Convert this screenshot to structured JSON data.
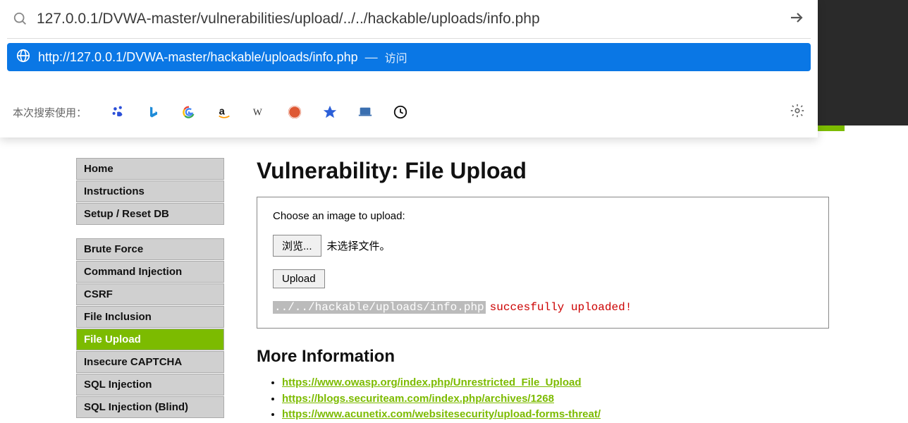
{
  "omnibox": {
    "value": "127.0.0.1/DVWA-master/vulnerabilities/upload/../../hackable/uploads/info.php"
  },
  "suggestion": {
    "url": "http://127.0.0.1/DVWA-master/hackable/uploads/info.php",
    "action": "访问"
  },
  "engines": {
    "label": "本次搜索使用："
  },
  "sidebar": {
    "group1": [
      "Home",
      "Instructions",
      "Setup / Reset DB"
    ],
    "group2": [
      "Brute Force",
      "Command Injection",
      "CSRF",
      "File Inclusion",
      "File Upload",
      "Insecure CAPTCHA",
      "SQL Injection",
      "SQL Injection (Blind)"
    ],
    "active": "File Upload"
  },
  "main": {
    "heading": "Vulnerability: File Upload",
    "prompt": "Choose an image to upload:",
    "browse": "浏览...",
    "file_status": "未选择文件。",
    "upload": "Upload",
    "result_path": "../../hackable/uploads/info.php",
    "result_msg": "succesfully uploaded!",
    "more_heading": "More Information",
    "links": [
      "https://www.owasp.org/index.php/Unrestricted_File_Upload",
      "https://blogs.securiteam.com/index.php/archives/1268",
      "https://www.acunetix.com/websitesecurity/upload-forms-threat/"
    ]
  }
}
